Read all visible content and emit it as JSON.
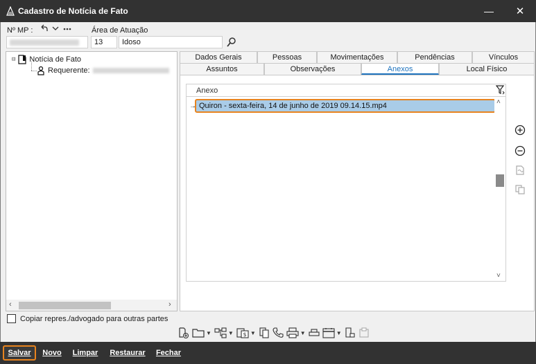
{
  "window": {
    "title": "Cadastro de Notícia de Fato",
    "minimize_glyph": "—",
    "close_glyph": "✕"
  },
  "header": {
    "mp_label": "Nº MP :",
    "area_label": "Área de Atuação",
    "area_code": "13",
    "area_name": "Idoso"
  },
  "tree": {
    "root_label": "Notícia de Fato",
    "root_expander": "⊟",
    "child_label": "Requerente:"
  },
  "copy_option": {
    "label": "Copiar repres./advogado para outras partes"
  },
  "tabs": {
    "row1": [
      "Dados Gerais",
      "Pessoas",
      "Movimentações",
      "Pendências",
      "Vínculos"
    ],
    "row2": [
      "Assuntos",
      "Observações",
      "Anexos",
      "Local Físico"
    ],
    "active": "Anexos"
  },
  "grid": {
    "column_header": "Anexo",
    "rows": [
      {
        "indicator": "→",
        "file": "Quiron - sexta-feira, 14 de junho de 2019 09.14.15.mp4"
      }
    ]
  },
  "footer": {
    "buttons": [
      "Salvar",
      "Novo",
      "Limpar",
      "Restaurar",
      "Fechar"
    ]
  },
  "colors": {
    "titlebar_bg": "#323232",
    "highlight_orange": "#e8831e",
    "selected_row": "#a9cce8",
    "active_tab": "#1e73be"
  }
}
